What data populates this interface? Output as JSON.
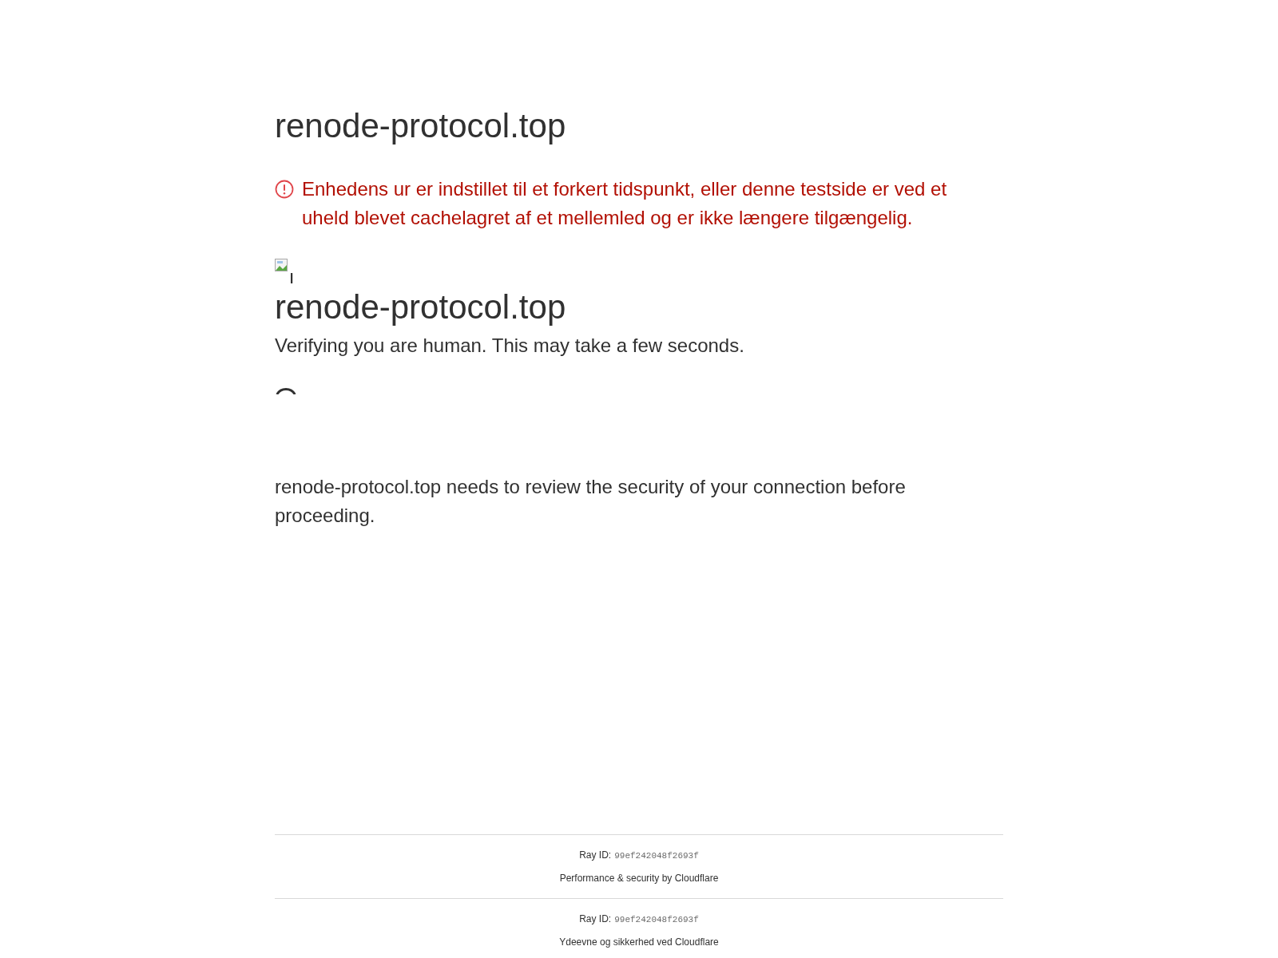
{
  "page": {
    "title": "renode-protocol.top"
  },
  "warning": {
    "text": "Enhedens ur er indstillet til et forkert tidspunkt, eller denne testside er ved et uheld blevet cachelagret af et mellemled og er ikke længere tilgængelig."
  },
  "challenge": {
    "heading": "renode-protocol.top",
    "status": "Verifying you are human. This may take a few seconds.",
    "message": "renode-protocol.top needs to review the security of your connection before proceeding."
  },
  "footer": [
    {
      "ray_id_label": "Ray ID:",
      "ray_id": "99ef242048f2693f",
      "credit": "Performance & security by Cloudflare"
    },
    {
      "ray_id_label": "Ray ID:",
      "ray_id": "99ef242048f2693f",
      "credit": "Ydeevne og sikkerhed ved Cloudflare"
    }
  ]
}
